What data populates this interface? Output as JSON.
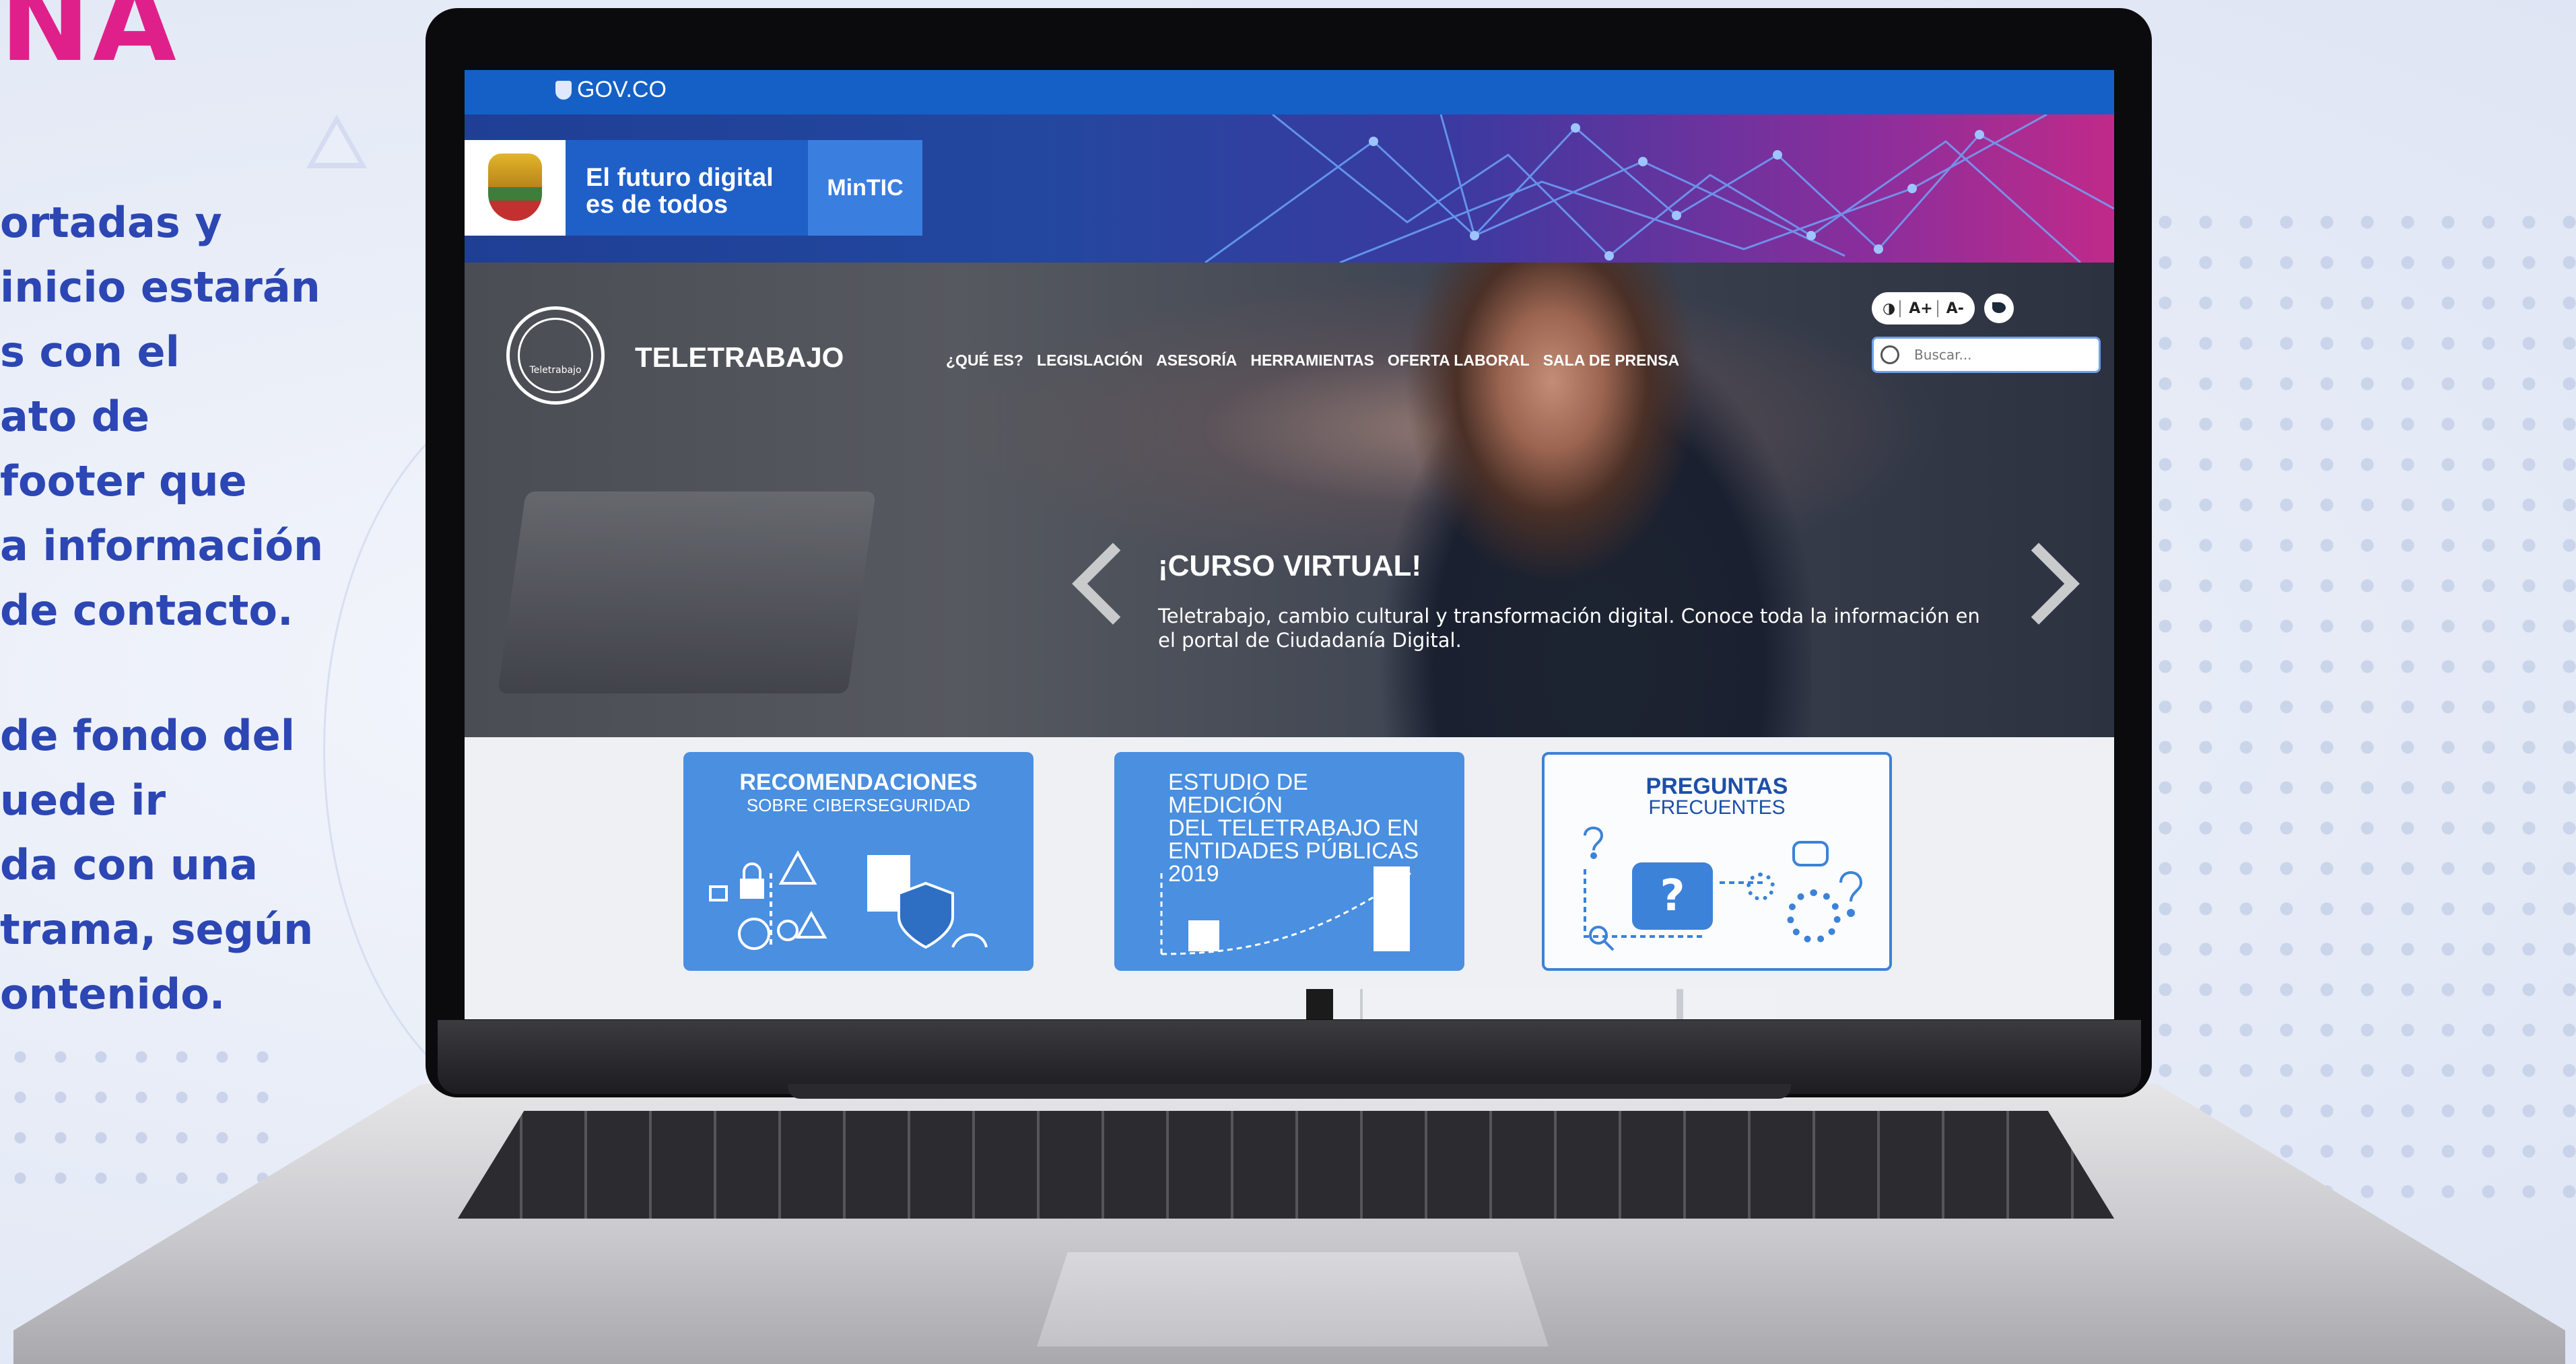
{
  "left_panel": {
    "heading_fragment": "NA",
    "paragraph1": "ortadas y\ninicio estarán\ns con el\nato de\nfooter que\na información\nde contacto.",
    "paragraph2": "de fondo del\nuede ir\nda con una\ntrama, según\nontenido."
  },
  "site": {
    "gov_label": "GOV.CO",
    "brand_text": "El futuro digital\nes de todos",
    "ministry": "MinTIC",
    "logo_small": "Teletrabajo",
    "name": "TELETRABAJO",
    "nav": [
      "¿QUÉ ES?",
      "LEGISLACIÓN",
      "ASESORÍA",
      "HERRAMIENTAS",
      "OFERTA LABORAL",
      "SALA DE PRENSA"
    ],
    "accessibility": {
      "contrast": "◑",
      "increase": "A+",
      "decrease": "A-"
    },
    "search_placeholder": "Buscar...",
    "slide": {
      "title": "¡CURSO VIRTUAL!",
      "description": "Teletrabajo, cambio cultural y transformación digital. Conoce toda la información en el portal de Ciudadanía Digital."
    },
    "cards": [
      {
        "title": "RECOMENDACIONES",
        "subtitle": "SOBRE CIBERSEGURIDAD"
      },
      {
        "title": "ESTUDIO DE MEDICIÓN\nDEL TELETRABAJO EN\nENTIDADES PÚBLICAS 2019"
      },
      {
        "title": "PREGUNTAS",
        "subtitle": "FRECUENTES"
      }
    ]
  },
  "colors": {
    "gov_blue": "#1560c6",
    "accent_pink": "#e0208a",
    "text_blue": "#2c46b4"
  }
}
